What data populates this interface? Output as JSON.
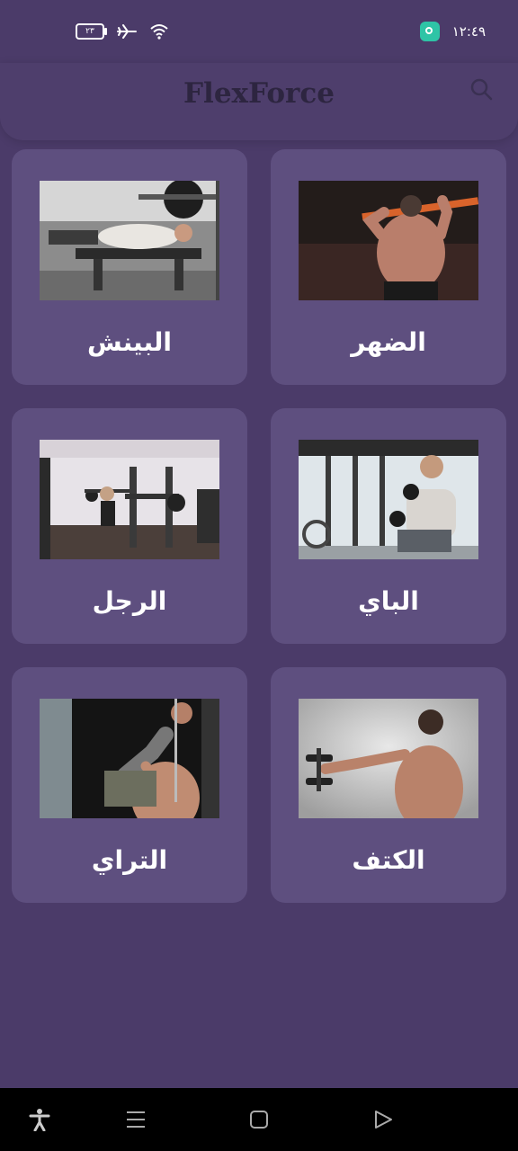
{
  "status_bar": {
    "battery_level": "٢٣",
    "time": "١٢:٤٩",
    "icons": [
      "battery-icon",
      "airplane-icon",
      "wifi-icon",
      "app-notification-icon"
    ]
  },
  "header": {
    "title": "FlexForce",
    "search_icon": "search-icon"
  },
  "categories": [
    {
      "label": "الضهر",
      "image": "back-workout-photo"
    },
    {
      "label": "البينش",
      "image": "bench-press-photo"
    },
    {
      "label": "الباي",
      "image": "biceps-curl-photo"
    },
    {
      "label": "الرجل",
      "image": "legs-gym-photo"
    },
    {
      "label": "الكتف",
      "image": "shoulder-raise-photo"
    },
    {
      "label": "التراي",
      "image": "triceps-pushdown-photo"
    }
  ],
  "nav_bar": {
    "icons": [
      "accessibility-icon",
      "menu-icon",
      "home-icon",
      "back-icon"
    ]
  },
  "colors": {
    "background": "#4b3b69",
    "card": "#5e4f7f",
    "title": "#2d2540"
  }
}
